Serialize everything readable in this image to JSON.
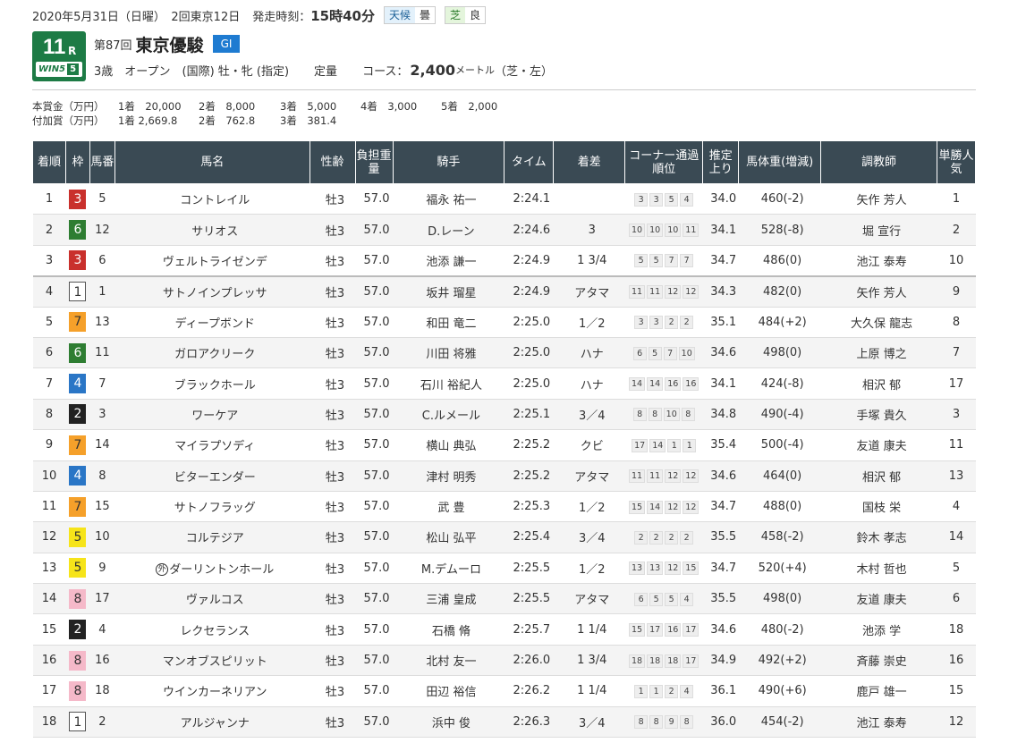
{
  "header": {
    "date_line": "2020年5月31日（日曜）　2回東京12日",
    "start_label": "発走時刻：",
    "start_time": "15時40分",
    "weather_label": "天候",
    "weather_value": "曇",
    "track_label": "芝",
    "track_value": "良"
  },
  "race": {
    "number": "11",
    "r_suffix": "R",
    "win5_label": "WIN5",
    "win5_num": "5",
    "edition": "第87回",
    "name": "東京優駿",
    "grade": "GI",
    "conditions": "3歳　オープン　(国際) 牡・牝 (指定)",
    "weight_rule": "定量",
    "course_label": "コース：",
    "course_distance": "2,400",
    "course_unit": "メートル",
    "course_detail": "（芝・左）"
  },
  "prize": {
    "main_label": "本賞金（万円）",
    "main": [
      "1着　20,000",
      "2着　8,000",
      "3着　5,000",
      "4着　3,000",
      "5着　2,000"
    ],
    "extra_label": "付加賞（万円）",
    "extra": [
      "1着 2,669.8",
      "2着　762.8",
      "3着　381.4"
    ]
  },
  "table": {
    "headers": [
      "着順",
      "枠",
      "馬番",
      "馬名",
      "性齢",
      "負担重量",
      "騎手",
      "タイム",
      "着差",
      "コーナー通過順位",
      "推定上り",
      "馬体重(増減)",
      "調教師",
      "単勝人気"
    ],
    "rows": [
      {
        "rank": "1",
        "bracket": "3",
        "num": "5",
        "name": "コントレイル",
        "sexage": "牡3",
        "load": "57.0",
        "jockey": "福永 祐一",
        "time": "2:24.1",
        "margin": "",
        "corner": [
          "3",
          "3",
          "5",
          "4"
        ],
        "last3f": "34.0",
        "weight": "460(-2)",
        "trainer": "矢作 芳人",
        "pop": "1"
      },
      {
        "rank": "2",
        "bracket": "6",
        "num": "12",
        "name": "サリオス",
        "sexage": "牡3",
        "load": "57.0",
        "jockey": "D.レーン",
        "time": "2:24.6",
        "margin": "3",
        "corner": [
          "10",
          "10",
          "10",
          "11"
        ],
        "last3f": "34.1",
        "weight": "528(-8)",
        "trainer": "堀 宣行",
        "pop": "2"
      },
      {
        "rank": "3",
        "bracket": "3",
        "num": "6",
        "name": "ヴェルトライゼンデ",
        "sexage": "牡3",
        "load": "57.0",
        "jockey": "池添 謙一",
        "time": "2:24.9",
        "margin": "1 3/4",
        "corner": [
          "5",
          "5",
          "7",
          "7"
        ],
        "last3f": "34.7",
        "weight": "486(0)",
        "trainer": "池江 泰寿",
        "pop": "10"
      },
      {
        "rank": "4",
        "bracket": "1",
        "num": "1",
        "name": "サトノインプレッサ",
        "sexage": "牡3",
        "load": "57.0",
        "jockey": "坂井 瑠星",
        "time": "2:24.9",
        "margin": "アタマ",
        "corner": [
          "11",
          "11",
          "12",
          "12"
        ],
        "last3f": "34.3",
        "weight": "482(0)",
        "trainer": "矢作 芳人",
        "pop": "9"
      },
      {
        "rank": "5",
        "bracket": "7",
        "num": "13",
        "name": "ディープボンド",
        "sexage": "牡3",
        "load": "57.0",
        "jockey": "和田 竜二",
        "time": "2:25.0",
        "margin": "1／2",
        "corner": [
          "3",
          "3",
          "2",
          "2"
        ],
        "last3f": "35.1",
        "weight": "484(+2)",
        "trainer": "大久保 龍志",
        "pop": "8"
      },
      {
        "rank": "6",
        "bracket": "6",
        "num": "11",
        "name": "ガロアクリーク",
        "sexage": "牡3",
        "load": "57.0",
        "jockey": "川田 将雅",
        "time": "2:25.0",
        "margin": "ハナ",
        "corner": [
          "6",
          "5",
          "7",
          "10"
        ],
        "last3f": "34.6",
        "weight": "498(0)",
        "trainer": "上原 博之",
        "pop": "7"
      },
      {
        "rank": "7",
        "bracket": "4",
        "num": "7",
        "name": "ブラックホール",
        "sexage": "牡3",
        "load": "57.0",
        "jockey": "石川 裕紀人",
        "time": "2:25.0",
        "margin": "ハナ",
        "corner": [
          "14",
          "14",
          "16",
          "16"
        ],
        "last3f": "34.1",
        "weight": "424(-8)",
        "trainer": "相沢 郁",
        "pop": "17"
      },
      {
        "rank": "8",
        "bracket": "2",
        "num": "3",
        "name": "ワーケア",
        "sexage": "牡3",
        "load": "57.0",
        "jockey": "C.ルメール",
        "time": "2:25.1",
        "margin": "3／4",
        "corner": [
          "8",
          "8",
          "10",
          "8"
        ],
        "last3f": "34.8",
        "weight": "490(-4)",
        "trainer": "手塚 貴久",
        "pop": "3"
      },
      {
        "rank": "9",
        "bracket": "7",
        "num": "14",
        "name": "マイラプソディ",
        "sexage": "牡3",
        "load": "57.0",
        "jockey": "横山 典弘",
        "time": "2:25.2",
        "margin": "クビ",
        "corner": [
          "17",
          "14",
          "1",
          "1"
        ],
        "last3f": "35.4",
        "weight": "500(-4)",
        "trainer": "友道 康夫",
        "pop": "11"
      },
      {
        "rank": "10",
        "bracket": "4",
        "num": "8",
        "name": "ビターエンダー",
        "sexage": "牡3",
        "load": "57.0",
        "jockey": "津村 明秀",
        "time": "2:25.2",
        "margin": "アタマ",
        "corner": [
          "11",
          "11",
          "12",
          "12"
        ],
        "last3f": "34.6",
        "weight": "464(0)",
        "trainer": "相沢 郁",
        "pop": "13"
      },
      {
        "rank": "11",
        "bracket": "7",
        "num": "15",
        "name": "サトノフラッグ",
        "sexage": "牡3",
        "load": "57.0",
        "jockey": "武 豊",
        "time": "2:25.3",
        "margin": "1／2",
        "corner": [
          "15",
          "14",
          "12",
          "12"
        ],
        "last3f": "34.7",
        "weight": "488(0)",
        "trainer": "国枝 栄",
        "pop": "4"
      },
      {
        "rank": "12",
        "bracket": "5",
        "num": "10",
        "name": "コルテジア",
        "sexage": "牡3",
        "load": "57.0",
        "jockey": "松山 弘平",
        "time": "2:25.4",
        "margin": "3／4",
        "corner": [
          "2",
          "2",
          "2",
          "2"
        ],
        "last3f": "35.5",
        "weight": "458(-2)",
        "trainer": "鈴木 孝志",
        "pop": "14"
      },
      {
        "rank": "13",
        "bracket": "5",
        "num": "9",
        "name": "ダーリントンホール",
        "foreign": "外",
        "sexage": "牡3",
        "load": "57.0",
        "jockey": "M.デムーロ",
        "time": "2:25.5",
        "margin": "1／2",
        "corner": [
          "13",
          "13",
          "12",
          "15"
        ],
        "last3f": "34.7",
        "weight": "520(+4)",
        "trainer": "木村 哲也",
        "pop": "5"
      },
      {
        "rank": "14",
        "bracket": "8",
        "num": "17",
        "name": "ヴァルコス",
        "sexage": "牡3",
        "load": "57.0",
        "jockey": "三浦 皇成",
        "time": "2:25.5",
        "margin": "アタマ",
        "corner": [
          "6",
          "5",
          "5",
          "4"
        ],
        "last3f": "35.5",
        "weight": "498(0)",
        "trainer": "友道 康夫",
        "pop": "6"
      },
      {
        "rank": "15",
        "bracket": "2",
        "num": "4",
        "name": "レクセランス",
        "sexage": "牡3",
        "load": "57.0",
        "jockey": "石橋 脩",
        "time": "2:25.7",
        "margin": "1 1/4",
        "corner": [
          "15",
          "17",
          "16",
          "17"
        ],
        "last3f": "34.6",
        "weight": "480(-2)",
        "trainer": "池添 学",
        "pop": "18"
      },
      {
        "rank": "16",
        "bracket": "8",
        "num": "16",
        "name": "マンオブスピリット",
        "sexage": "牡3",
        "load": "57.0",
        "jockey": "北村 友一",
        "time": "2:26.0",
        "margin": "1 3/4",
        "corner": [
          "18",
          "18",
          "18",
          "17"
        ],
        "last3f": "34.9",
        "weight": "492(+2)",
        "trainer": "斉藤 崇史",
        "pop": "16"
      },
      {
        "rank": "17",
        "bracket": "8",
        "num": "18",
        "name": "ウインカーネリアン",
        "sexage": "牡3",
        "load": "57.0",
        "jockey": "田辺 裕信",
        "time": "2:26.2",
        "margin": "1 1/4",
        "corner": [
          "1",
          "1",
          "2",
          "4"
        ],
        "last3f": "36.1",
        "weight": "490(+6)",
        "trainer": "鹿戸 雄一",
        "pop": "15"
      },
      {
        "rank": "18",
        "bracket": "1",
        "num": "2",
        "name": "アルジャンナ",
        "sexage": "牡3",
        "load": "57.0",
        "jockey": "浜中 俊",
        "time": "2:26.3",
        "margin": "3／4",
        "corner": [
          "8",
          "8",
          "9",
          "8"
        ],
        "last3f": "36.0",
        "weight": "454(-2)",
        "trainer": "池江 泰寿",
        "pop": "12"
      }
    ]
  }
}
